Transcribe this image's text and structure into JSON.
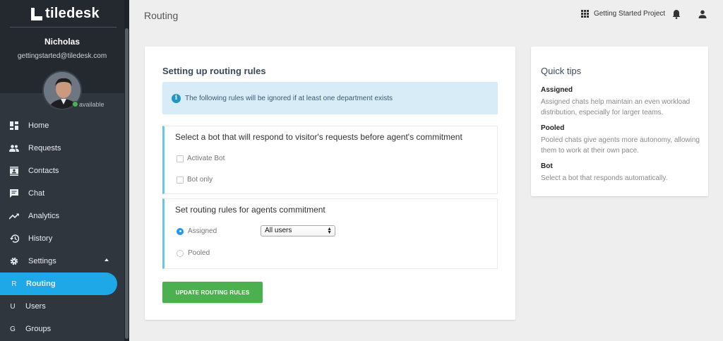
{
  "app": {
    "logo": "tiledesk"
  },
  "user": {
    "name": "Nicholas",
    "email": "gettingstarted@tiledesk.com",
    "status": "available"
  },
  "nav": {
    "home": "Home",
    "requests": "Requests",
    "contacts": "Contacts",
    "chat": "Chat",
    "analytics": "Analytics",
    "history": "History",
    "settings": "Settings",
    "routing": {
      "initial": "R",
      "label": "Routing"
    },
    "users": {
      "initial": "U",
      "label": "Users"
    },
    "groups": {
      "initial": "G",
      "label": "Groups"
    }
  },
  "topbar": {
    "title": "Routing",
    "project": "Getting Started Project"
  },
  "main": {
    "title": "Setting up routing rules",
    "info": "The following rules will be ignored if at least one department exists",
    "bot_section": {
      "title": "Select a bot that will respond to visitor's requests before agent's commitment",
      "activate_bot": "Activate Bot",
      "bot_only": "Bot only"
    },
    "routing_section": {
      "title": "Set routing rules for agents commitment",
      "assigned": "Assigned",
      "pooled": "Pooled",
      "select_value": "All users"
    },
    "button": "UPDATE ROUTING RULES"
  },
  "tips": {
    "title": "Quick tips",
    "items": [
      {
        "heading": "Assigned",
        "text": "Assigned chats help maintain an even workload distribution, especially for larger teams."
      },
      {
        "heading": "Pooled",
        "text": "Pooled chats give agents more autonomy, allowing them to work at their own pace."
      },
      {
        "heading": "Bot",
        "text": "Select a bot that responds automatically."
      }
    ]
  },
  "colors": {
    "accent": "#1ea8e7",
    "button": "#4caf50",
    "sidebar": "#2f363e"
  }
}
